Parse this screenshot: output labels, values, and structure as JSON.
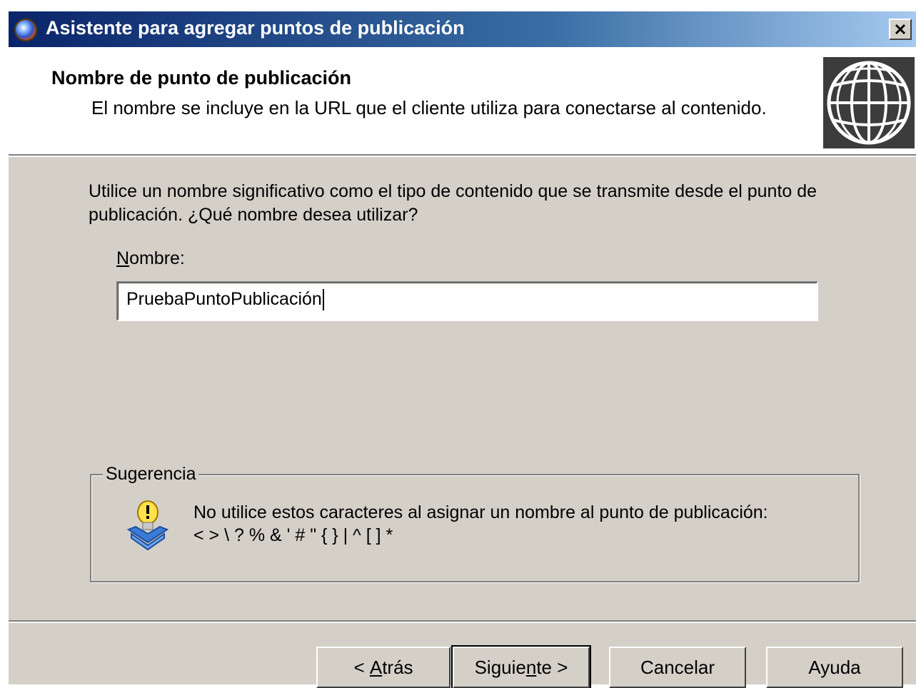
{
  "window": {
    "title": "Asistente para agregar puntos de publicación",
    "close_label": "×"
  },
  "header": {
    "title": "Nombre de punto de publicación",
    "subtitle": "El nombre se incluye en la URL que el cliente utiliza para conectarse al contenido."
  },
  "body": {
    "prompt": "Utilice un nombre significativo como el tipo de contenido que se transmite desde el punto de publicación. ¿Qué nombre desea utilizar?",
    "name_label_mnemonic": "N",
    "name_label_rest": "ombre:",
    "name_value": "PruebaPuntoPublicación"
  },
  "tip": {
    "legend": "Sugerencia",
    "line1": "No utilice estos caracteres al asignar un nombre al punto de publicación:",
    "line2": "< > \\ ? % & ' # \" { } | ^ [ ] *"
  },
  "buttons": {
    "back_prefix": "< ",
    "back_mnemonic": "A",
    "back_rest": "trás",
    "next_prefix": "Siguie",
    "next_mnemonic": "n",
    "next_rest": "te >",
    "cancel": "Cancelar",
    "help": "Ayuda"
  },
  "colors": {
    "titlebar_start": "#0a246a",
    "titlebar_end": "#a6caf0",
    "dialog_face": "#d4d0c8"
  },
  "icons": [
    "app-globe-icon",
    "close-icon",
    "globe-icon",
    "tip-lightbulb-icon"
  ]
}
